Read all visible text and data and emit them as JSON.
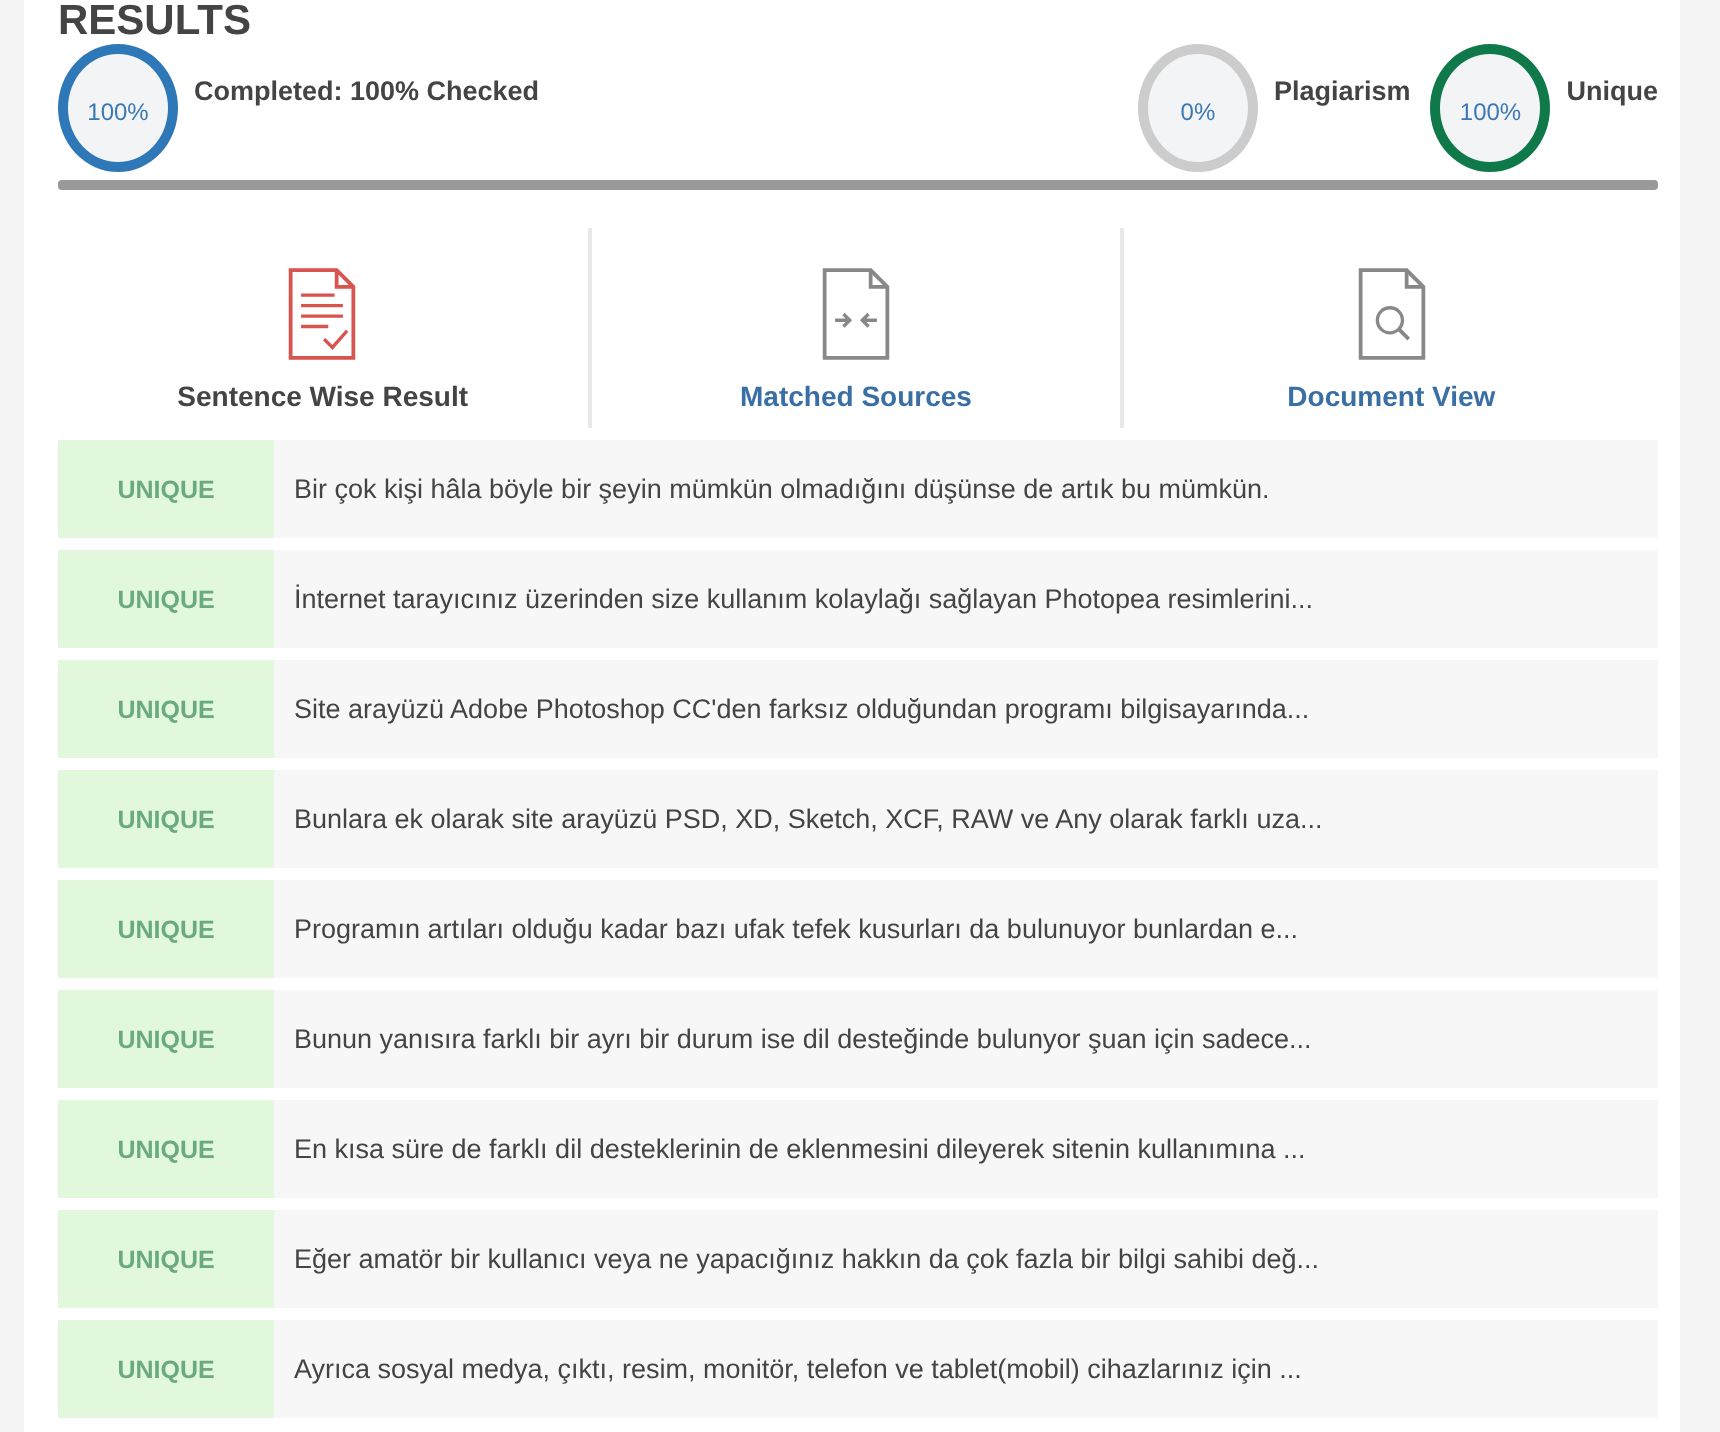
{
  "title": "RESULTS",
  "progress": {
    "value": "100%",
    "label": "Completed: 100% Checked",
    "color": "#2f78b7",
    "level": 1
  },
  "stats": [
    {
      "value": "0%",
      "label": "Plagiarism",
      "color": "#cccccc"
    },
    {
      "value": "100%",
      "label": "Unique",
      "color": "#10794a"
    }
  ],
  "tabs": [
    {
      "label": "Sentence Wise Result",
      "kind": "sentences",
      "selected": true
    },
    {
      "label": "Matched Sources",
      "kind": "sources",
      "selected": false
    },
    {
      "label": "Document View",
      "kind": "document",
      "selected": false
    }
  ],
  "rows": [
    {
      "status": "UNIQUE",
      "text": "Bir çok kişi hâla böyle bir şeyin mümkün olmadığını düşünse de artık bu mümkün."
    },
    {
      "status": "UNIQUE",
      "text": "İnternet tarayıcınız üzerinden size kullanım kolaylağı sağlayan Photopea resimlerini..."
    },
    {
      "status": "UNIQUE",
      "text": "Site arayüzü Adobe Photoshop CC'den farksız olduğundan programı bilgisayarında..."
    },
    {
      "status": "UNIQUE",
      "text": "Bunlara ek olarak site arayüzü PSD, XD, Sketch, XCF, RAW ve Any olarak farklı uza..."
    },
    {
      "status": "UNIQUE",
      "text": "Programın artıları olduğu kadar bazı ufak tefek kusurları da bulunuyor bunlardan e..."
    },
    {
      "status": "UNIQUE",
      "text": "Bunun yanısıra farklı bir ayrı bir durum ise dil desteğinde bulunyor şuan için sadece..."
    },
    {
      "status": "UNIQUE",
      "text": "En kısa süre de farklı dil desteklerinin de eklenmesini dileyerek sitenin kullanımına ..."
    },
    {
      "status": "UNIQUE",
      "text": "Eğer amatör bir kullanıcı veya ne yapacığınız hakkın da çok fazla bir bilgi sahibi değ..."
    },
    {
      "status": "UNIQUE",
      "text": "Ayrıca sosyal medya, çıktı, resim, monitör, telefon ve tablet(mobil) cihazlarınız için ..."
    }
  ]
}
